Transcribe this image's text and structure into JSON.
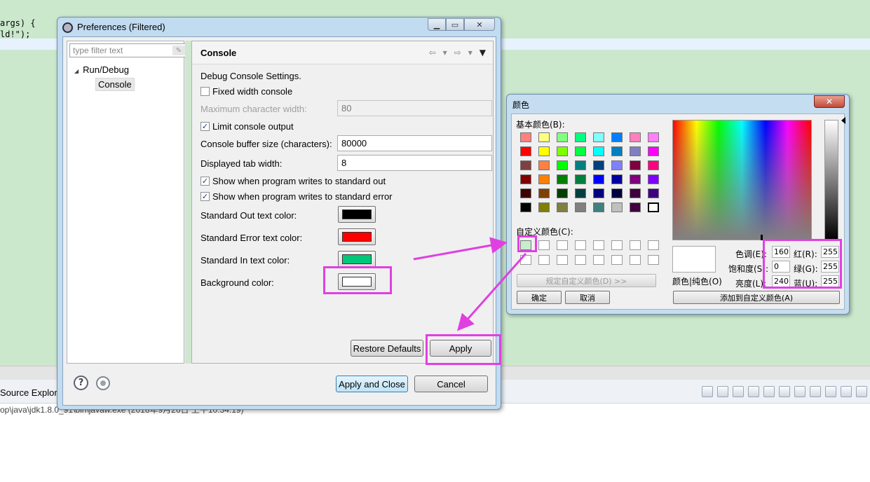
{
  "editor": {
    "code_line_1": "args) {",
    "code_line_2": "ld!\");",
    "bottom_tab": "Source Explore",
    "console_path": "op\\java\\jdk1.8.0_91\\bin\\javaw.exe (2018年9月26日 上午10:34:19)"
  },
  "preferences": {
    "title": "Preferences (Filtered)",
    "filter_placeholder": "type filter text",
    "tree": {
      "parent": "Run/Debug",
      "child": "Console"
    },
    "page_title": "Console",
    "section_label": "Debug Console Settings.",
    "fixed_width": {
      "label": "Fixed width console",
      "checked": false
    },
    "max_char_width": {
      "label": "Maximum character width:",
      "value": "80"
    },
    "limit_output": {
      "label": "Limit console output",
      "checked": true
    },
    "buffer_size": {
      "label": "Console buffer size (characters):",
      "value": "80000"
    },
    "tab_width": {
      "label": "Displayed tab width:",
      "value": "8"
    },
    "show_stdout": {
      "label": "Show when program writes to standard out",
      "checked": true
    },
    "show_stderr": {
      "label": "Show when program writes to standard error",
      "checked": true
    },
    "std_out_color": {
      "label": "Standard Out text color:",
      "color": "#000000"
    },
    "std_err_color": {
      "label": "Standard Error text color:",
      "color": "#ff0000"
    },
    "std_in_color": {
      "label": "Standard In text color:",
      "color": "#00c87a"
    },
    "bg_color": {
      "label": "Background color:",
      "color": "#ffffff"
    },
    "restore_defaults": "Restore Defaults",
    "apply": "Apply",
    "apply_close": "Apply and Close",
    "cancel": "Cancel"
  },
  "color_dialog": {
    "title": "颜色",
    "basic_colors_label": "基本颜色(B):",
    "basic_colors": [
      "#ff8080",
      "#ffff80",
      "#80ff80",
      "#00ff80",
      "#80ffff",
      "#0080ff",
      "#ff80c0",
      "#ff80ff",
      "#ff0000",
      "#ffff00",
      "#80ff00",
      "#00ff40",
      "#00ffff",
      "#0080c0",
      "#8080c0",
      "#ff00ff",
      "#804040",
      "#ff8040",
      "#00ff00",
      "#008080",
      "#004080",
      "#8080ff",
      "#800040",
      "#ff0080",
      "#800000",
      "#ff8000",
      "#008000",
      "#008040",
      "#0000ff",
      "#0000a0",
      "#800080",
      "#8000ff",
      "#400000",
      "#804000",
      "#004000",
      "#004040",
      "#000080",
      "#000040",
      "#400040",
      "#400080",
      "#000000",
      "#808000",
      "#808040",
      "#808080",
      "#408080",
      "#c0c0c0",
      "#400040",
      "#ffffff"
    ],
    "custom_colors_label": "自定义颜色(C):",
    "custom_first": "#c7edcc",
    "define_custom": "规定自定义颜色(D) >>",
    "ok": "确定",
    "cancel": "取消",
    "color_solid": "颜色|纯色(O)",
    "hue_label": "色调(E):",
    "hue": "160",
    "sat_label": "饱和度(S):",
    "sat": "0",
    "lum_label": "亮度(L):",
    "lum": "240",
    "red_label": "红(R):",
    "red": "255",
    "green_label": "绿(G):",
    "green": "255",
    "blue_label": "蓝(U):",
    "blue": "255",
    "add_custom": "添加到自定义颜色(A)"
  },
  "accent_color": "#e040e0"
}
